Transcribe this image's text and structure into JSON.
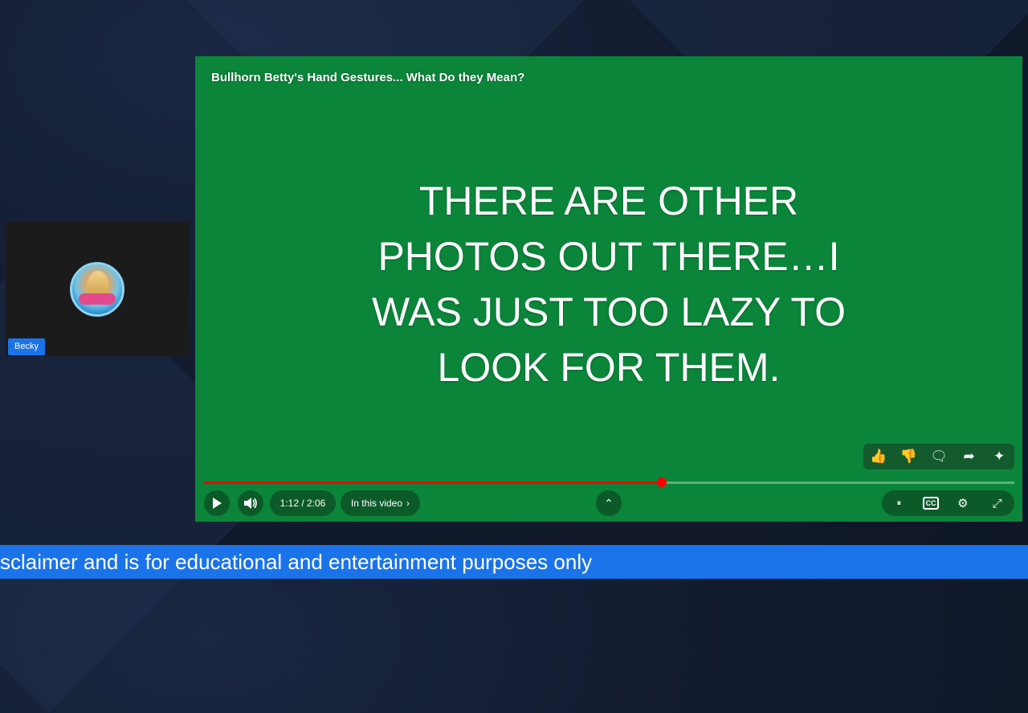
{
  "participant": {
    "name": "Becky",
    "avatar_icon": "profile-avatar"
  },
  "video": {
    "title": "Bullhorn Betty's Hand Gestures... What Do they Mean?",
    "slide_lines": [
      "THERE ARE OTHER",
      "PHOTOS OUT THERE…I",
      "WAS JUST TOO LAZY TO",
      "LOOK FOR THEM."
    ],
    "time_display": "1:12 / 2:06",
    "progress": 0.565,
    "in_this_video_label": "In this video",
    "background_color": "#0a8539",
    "progress_color": "#ff0000"
  },
  "ticker": {
    "text": "sclaimer and is for educational and entertainment purposes only",
    "color": "#1a73e8"
  }
}
